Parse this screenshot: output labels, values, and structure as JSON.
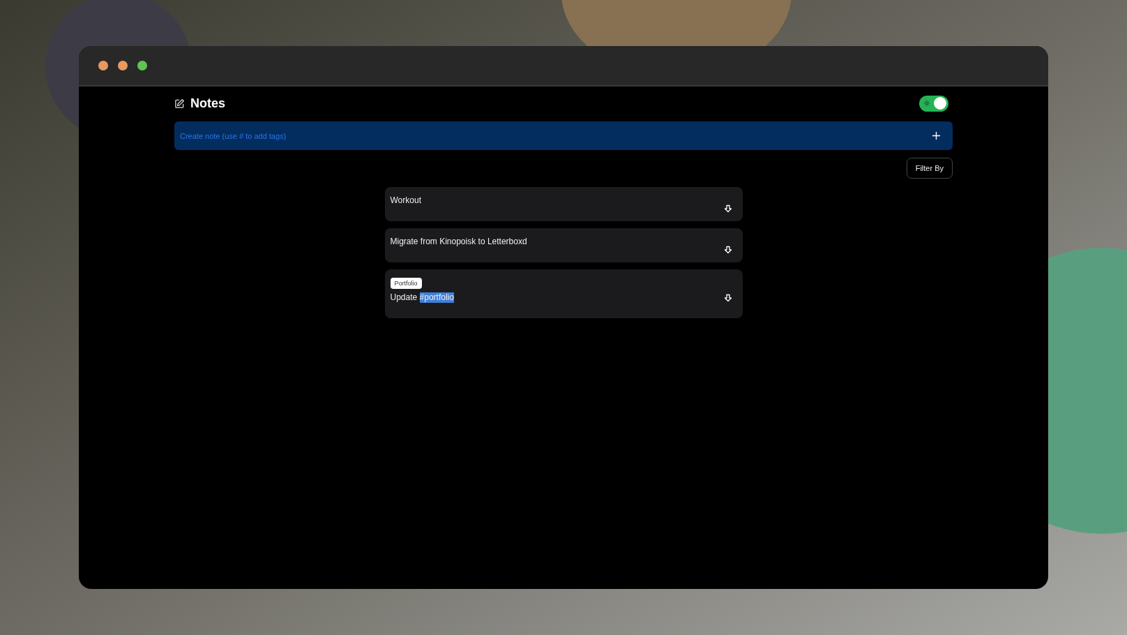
{
  "window": {
    "controls": [
      {
        "color": "#e8995e"
      },
      {
        "color": "#e8995e"
      },
      {
        "color": "#5fc454"
      }
    ]
  },
  "header": {
    "title": "Notes",
    "theme_toggle": {
      "on": true
    }
  },
  "create_note": {
    "placeholder": "Create note (use # to add tags)"
  },
  "filter_button": "Filter By",
  "notes": [
    {
      "segments": [
        {
          "text": "Workout",
          "selected": false
        }
      ]
    },
    {
      "segments": [
        {
          "text": "Migrate from Kinopoisk to Letterboxd",
          "selected": false
        }
      ]
    },
    {
      "tag": "Portfolio",
      "segments": [
        {
          "text": "Update ",
          "selected": false
        },
        {
          "text": "#portfolio",
          "selected": true
        }
      ]
    }
  ]
}
